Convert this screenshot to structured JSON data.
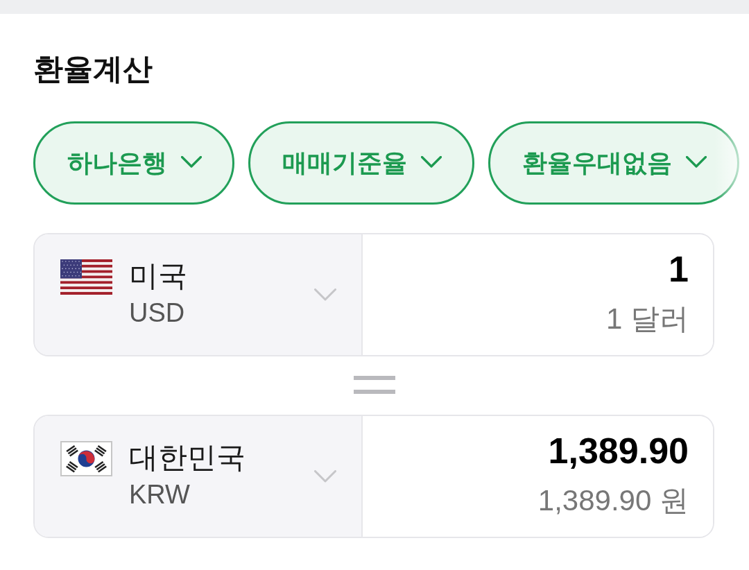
{
  "title": "환율계산",
  "filters": [
    {
      "label": "하나은행"
    },
    {
      "label": "매매기준율"
    },
    {
      "label": "환율우대없음"
    }
  ],
  "converter": [
    {
      "country": "미국",
      "code": "USD",
      "amount": "1",
      "amount_in_words": "1 달러"
    },
    {
      "country": "대한민국",
      "code": "KRW",
      "amount": "1,389.90",
      "amount_in_words": "1,389.90 원"
    }
  ]
}
